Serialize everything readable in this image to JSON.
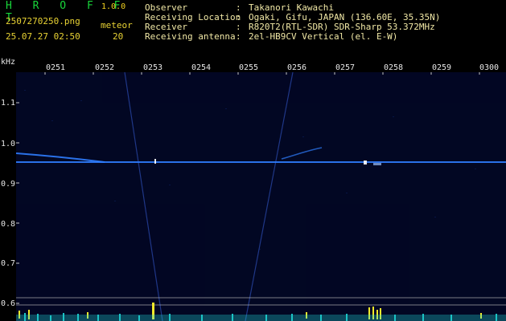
{
  "header": {
    "brand": "H R O F F T",
    "version": "1.0.0",
    "filename": "2507270250.png",
    "datetime": "25.07.27 02:50",
    "meteor_label": "meteor",
    "meteor_count": "20"
  },
  "info": [
    {
      "key": "Observer",
      "value": "Takanori Kawachi"
    },
    {
      "key": "Receiving Location",
      "value": "Ogaki, Gifu, JAPAN (136.60E, 35.35N)"
    },
    {
      "key": "Receiver",
      "value": "R820T2(RTL-SDR) SDR-Sharp 53.372MHz"
    },
    {
      "key": "Receiving antenna",
      "value": "2el-HB9CV Vertical (el. E-W)"
    }
  ],
  "axes": {
    "y_unit": "kHz",
    "y_ticks": [
      "1.1",
      "1.0",
      "0.9",
      "0.8",
      "0.7",
      "0.6"
    ],
    "x_ticks": [
      "0251",
      "0252",
      "0253",
      "0254",
      "0255",
      "0256",
      "0257",
      "0258",
      "0259",
      "0300"
    ]
  },
  "colors": {
    "background": "#000000",
    "plot_background": "#020620",
    "carrier_line": "#2f7dff",
    "noise_bars": "#1fd8d8",
    "meteor_spikes": "#f2ea2a",
    "header_text": "#e9d334",
    "brand_text": "#18d63a"
  }
}
